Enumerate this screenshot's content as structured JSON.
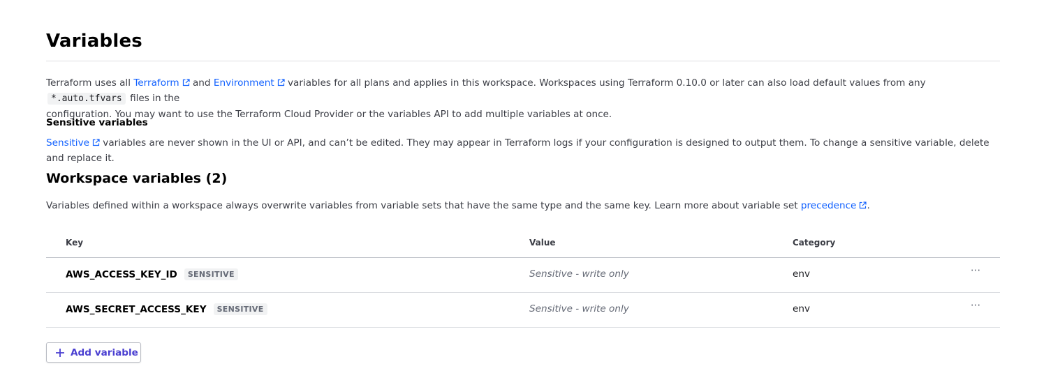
{
  "header": {
    "title": "Variables"
  },
  "intro": {
    "text_before_terraform": "Terraform uses all ",
    "terraform_link": "Terraform",
    "text_and": " and ",
    "environment_link": "Environment",
    "text_after_env": " variables for all plans and applies in this workspace. Workspaces using Terraform 0.10.0 or later can also load default values from any ",
    "code": "*.auto.tfvars",
    "text_after_code_line1": " files in the",
    "text_line2": "configuration. You may want to use the Terraform Cloud Provider or the variables API to add multiple variables at once."
  },
  "sensitive_section": {
    "heading": "Sensitive variables",
    "link": "Sensitive",
    "text": " variables are never shown in the UI or API, and can’t be edited. They may appear in Terraform logs if your configuration is designed to output them. To change a sensitive variable, delete and replace it."
  },
  "workspace_section": {
    "heading": "Workspace variables (2)",
    "text_before_link": "Variables defined within a workspace always overwrite variables from variable sets that have the same type and the same key. Learn more about variable set ",
    "link": "precedence",
    "text_after_link": "."
  },
  "table": {
    "columns": {
      "key": "Key",
      "value": "Value",
      "category": "Category"
    },
    "rows": [
      {
        "key": "AWS_ACCESS_KEY_ID",
        "badge": "SENSITIVE",
        "value": "Sensitive - write only",
        "category": "env",
        "menu": "···"
      },
      {
        "key": "AWS_SECRET_ACCESS_KEY",
        "badge": "SENSITIVE",
        "value": "Sensitive - write only",
        "category": "env",
        "menu": "···"
      }
    ]
  },
  "actions": {
    "add_variable_label": "Add variable"
  },
  "colors": {
    "link": "#1060ff",
    "button_text": "#4a3fd1",
    "muted": "#656a76"
  },
  "icons": {
    "external": "external-link-icon",
    "plus": "plus-icon",
    "more": "more-horizontal-icon"
  }
}
